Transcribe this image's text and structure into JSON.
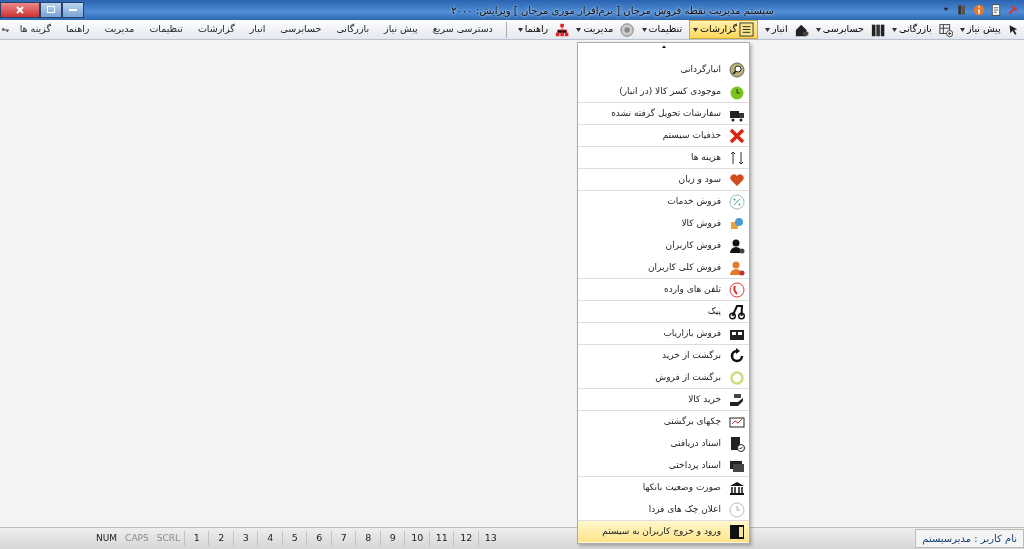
{
  "window": {
    "title": "سیستم مدیریت نقطه فروش مرجان [ نرم‌افزار موزی مرجان ]",
    "version": "ویرایش: ۲۰۰۰"
  },
  "toolbar": [
    {
      "label": "پیش نیاز",
      "selected": false
    },
    {
      "label": "بازرگانی",
      "selected": false
    },
    {
      "label": "حسابرسی",
      "selected": false
    },
    {
      "label": "انبار",
      "selected": false
    },
    {
      "label": "گزارشات",
      "selected": true
    },
    {
      "label": "تنظیمات",
      "selected": false
    },
    {
      "label": "مدیریت",
      "selected": false
    },
    {
      "label": "راهنما",
      "selected": false
    }
  ],
  "menubar": [
    {
      "label": "دسترسی سریع"
    },
    {
      "label": "پیش نیاز"
    },
    {
      "label": "بازرگانی"
    },
    {
      "label": "حسابرسی"
    },
    {
      "label": "انبار"
    },
    {
      "label": "گزارشات"
    },
    {
      "label": "تنظیمات"
    },
    {
      "label": "مدیریت"
    },
    {
      "label": "راهنما"
    },
    {
      "label": "گزینه ها"
    }
  ],
  "menu": {
    "items": [
      {
        "label": "انبارگردانی",
        "selected": false,
        "group_end": false
      },
      {
        "label": "موجودی کسر کالا (در انبار)",
        "selected": false,
        "group_end": true
      },
      {
        "label": "سفارشات تحویل گرفته نشده",
        "selected": false,
        "group_end": true
      },
      {
        "label": "حذفیات سیستم",
        "selected": false,
        "group_end": true
      },
      {
        "label": "هزینه ها",
        "selected": false,
        "group_end": true
      },
      {
        "label": "سود و زیان",
        "selected": false,
        "group_end": true
      },
      {
        "label": "فروش خدمات",
        "selected": false,
        "group_end": false
      },
      {
        "label": "فروش کالا",
        "selected": false,
        "group_end": false
      },
      {
        "label": "فروش کاربران",
        "selected": false,
        "group_end": false
      },
      {
        "label": "فروش کلی کاربران",
        "selected": false,
        "group_end": true
      },
      {
        "label": "تلفن های وارده",
        "selected": false,
        "group_end": true
      },
      {
        "label": "پیک",
        "selected": false,
        "group_end": true
      },
      {
        "label": "فروش بازاریاب",
        "selected": false,
        "group_end": true
      },
      {
        "label": "برگشت از خرید",
        "selected": false,
        "group_end": false
      },
      {
        "label": "برگشت از فروش",
        "selected": false,
        "group_end": true
      },
      {
        "label": "خرید کالا",
        "selected": false,
        "group_end": true
      },
      {
        "label": "چکهای برگشتی",
        "selected": false,
        "group_end": false
      },
      {
        "label": "اسناد دریافتی",
        "selected": false,
        "group_end": false
      },
      {
        "label": "اسناد پرداختی",
        "selected": false,
        "group_end": true
      },
      {
        "label": "صورت وضعیت بانکها",
        "selected": false,
        "group_end": false
      },
      {
        "label": "اعلان چک های فردا",
        "selected": false,
        "group_end": true
      },
      {
        "label": "ورود و خروج کاربران به سیستم",
        "selected": true,
        "group_end": false
      }
    ]
  },
  "status_bar": {
    "user": "نام کاربر : مدیرسیستم",
    "pages": [
      "13",
      "12",
      "11",
      "10",
      "9",
      "8",
      "7",
      "6",
      "5",
      "4",
      "3",
      "2",
      "1"
    ],
    "keys": [
      {
        "label": "SCRL",
        "disabled": true
      },
      {
        "label": "CAPS",
        "disabled": true
      },
      {
        "label": "NUM",
        "disabled": false
      }
    ]
  }
}
